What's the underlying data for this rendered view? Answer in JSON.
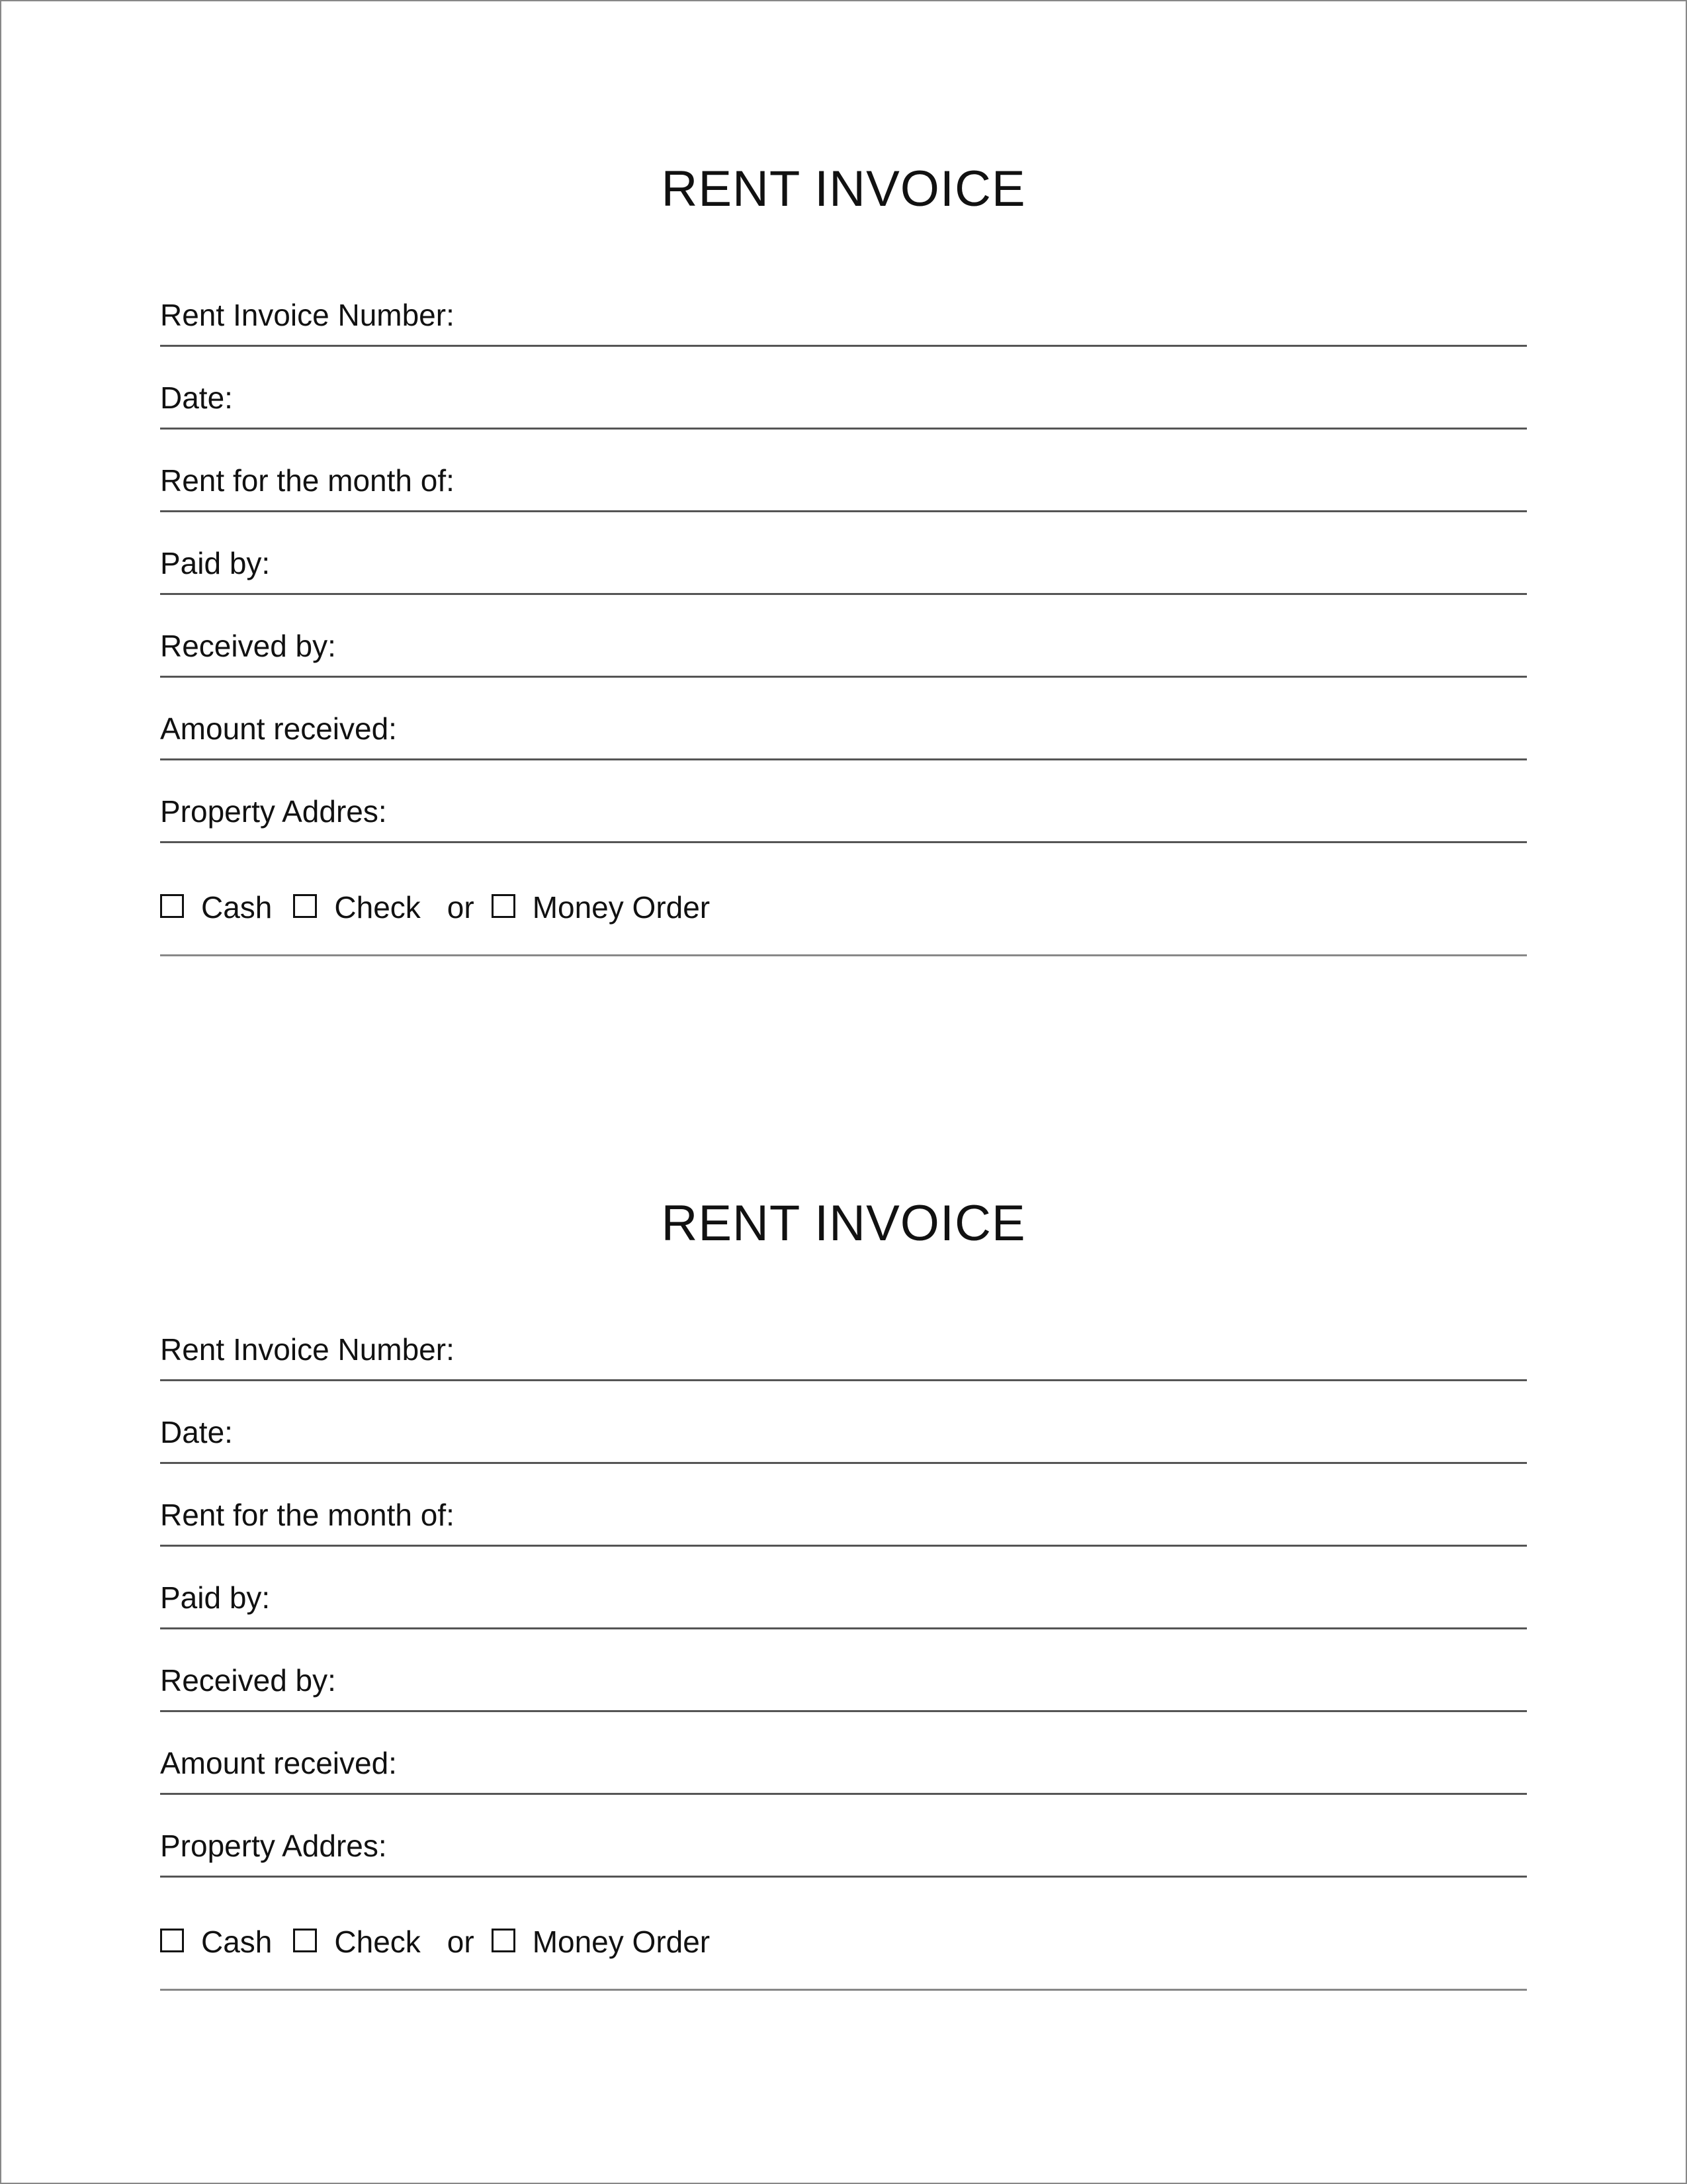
{
  "invoice1": {
    "title": "RENT INVOICE",
    "fields": {
      "invoice_number": "Rent Invoice Number:",
      "date": "Date:",
      "rent_month": "Rent for the month of:",
      "paid_by": "Paid by:",
      "received_by": "Received by:",
      "amount_received": "Amount received:",
      "property_address": "Property Addres:"
    },
    "payment": {
      "cash": "Cash",
      "check": "Check",
      "or": "or",
      "money_order": "Money Order"
    }
  },
  "invoice2": {
    "title": "RENT INVOICE",
    "fields": {
      "invoice_number": "Rent Invoice Number:",
      "date": "Date:",
      "rent_month": "Rent for the month of:",
      "paid_by": "Paid by:",
      "received_by": "Received by:",
      "amount_received": "Amount received:",
      "property_address": "Property Addres:"
    },
    "payment": {
      "cash": "Cash",
      "check": "Check",
      "or": "or",
      "money_order": "Money Order"
    }
  }
}
